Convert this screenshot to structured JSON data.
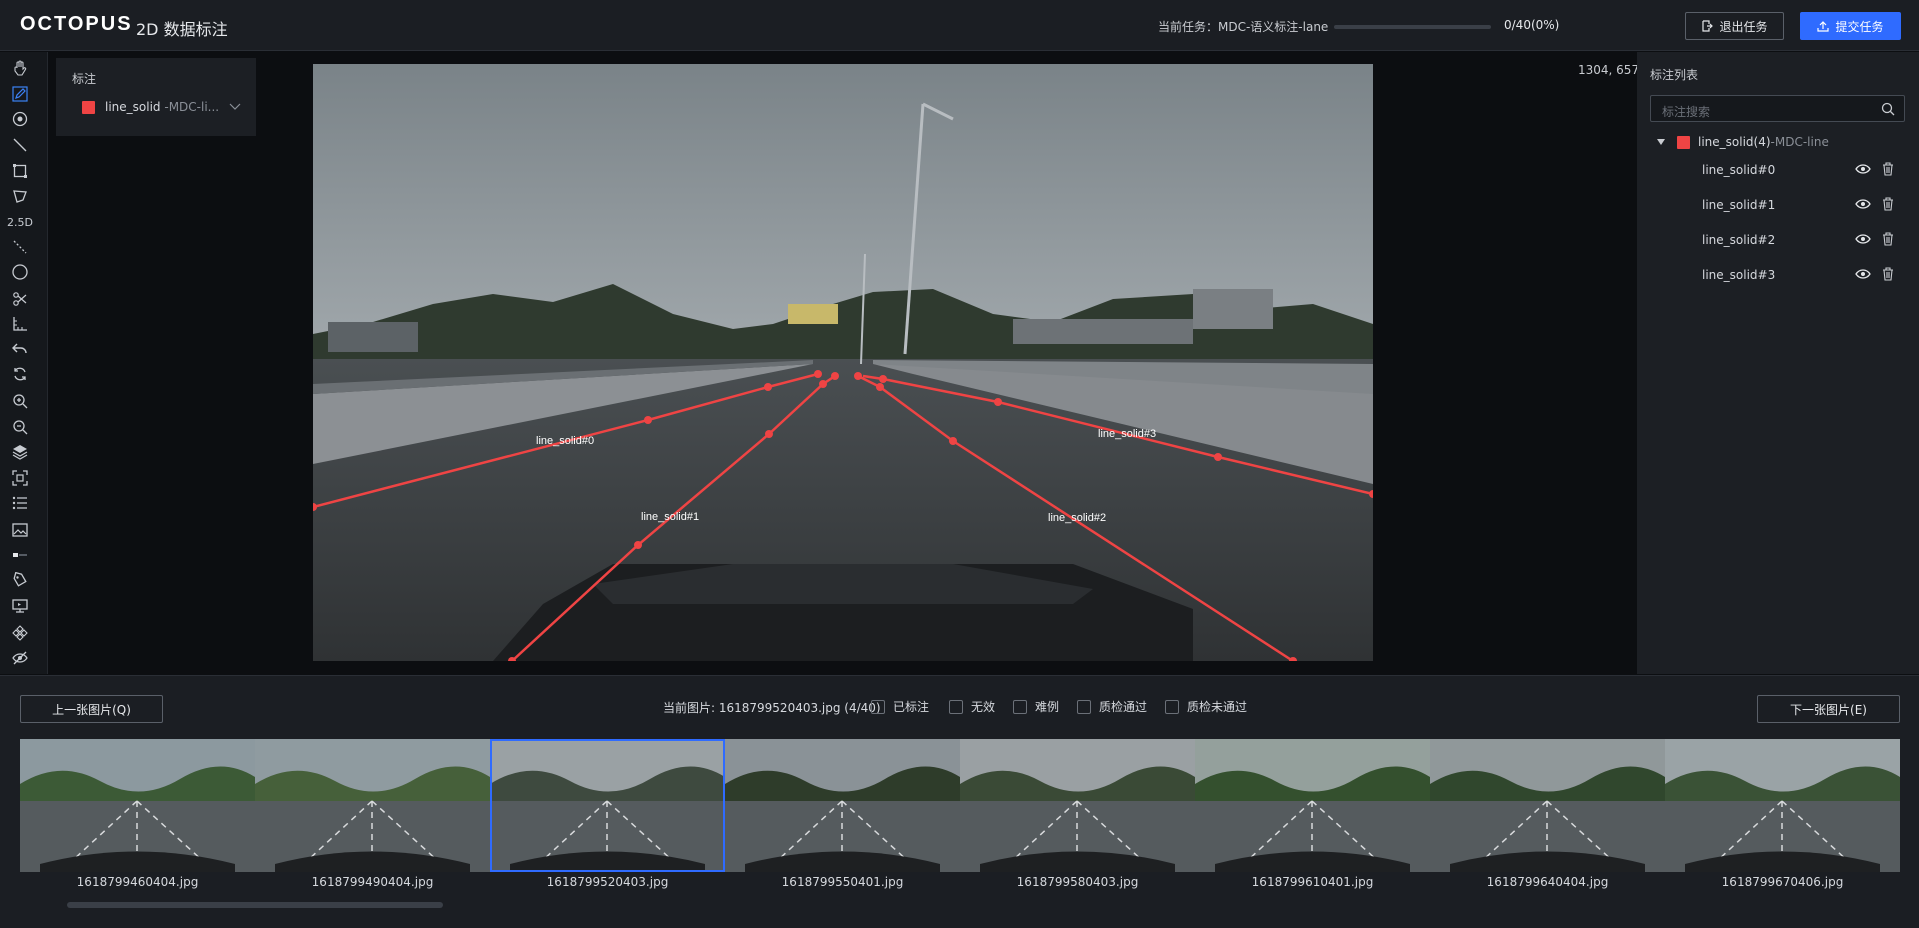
{
  "header": {
    "logo": "OCTOPUS",
    "subtitle": "2D 数据标注",
    "task_label": "当前任务：MDC-语义标注-lane",
    "progress_text": "0/40(0%)",
    "progress_fraction": 0,
    "exit_label": "退出任务",
    "submit_label": "提交任务"
  },
  "toolbar": {
    "tools": [
      "hand-icon",
      "pencil-icon",
      "point-icon",
      "line-icon",
      "rect-icon",
      "polygon-icon",
      "2.5D",
      "dashed-line-icon",
      "circle-icon",
      "scissors-icon",
      "ruler-icon",
      "undo-icon",
      "rotate-icon",
      "zoom-in-icon",
      "zoom-out-icon",
      "layers-icon",
      "fit-icon",
      "list-icon",
      "image-icon",
      "toggle-icon",
      "tag-icon",
      "monitor-icon",
      "grid-icon",
      "hide-icon"
    ],
    "label_25d": "2.5D"
  },
  "annotation_panel": {
    "title": "标注",
    "item_label": "line_solid",
    "item_sub": " -MDC-li...",
    "color": "#ef4444"
  },
  "canvas": {
    "coords": "1304, 657",
    "lines": [
      {
        "name": "line_solid#0"
      },
      {
        "name": "line_solid#1"
      },
      {
        "name": "line_solid#2"
      },
      {
        "name": "line_solid#3"
      }
    ]
  },
  "right_panel": {
    "title": "标注列表",
    "search_placeholder": "标注搜索",
    "group_label": "line_solid(4)",
    "group_sub": "-MDC-line",
    "items": [
      "line_solid#0",
      "line_solid#1",
      "line_solid#2",
      "line_solid#3"
    ]
  },
  "bottom": {
    "prev_label": "上一张图片(Q)",
    "next_label": "下一张图片(E)",
    "current_image": "当前图片: 1618799520403.jpg (4/40)",
    "checks": [
      "已标注",
      "无效",
      "难例",
      "质检通过",
      "质检未通过"
    ],
    "thumbnails": [
      "1618799460404.jpg",
      "1618799490404.jpg",
      "1618799520403.jpg",
      "1618799550401.jpg",
      "1618799580403.jpg",
      "1618799610401.jpg",
      "1618799640404.jpg",
      "1618799670406.jpg"
    ],
    "selected_index": 2
  }
}
